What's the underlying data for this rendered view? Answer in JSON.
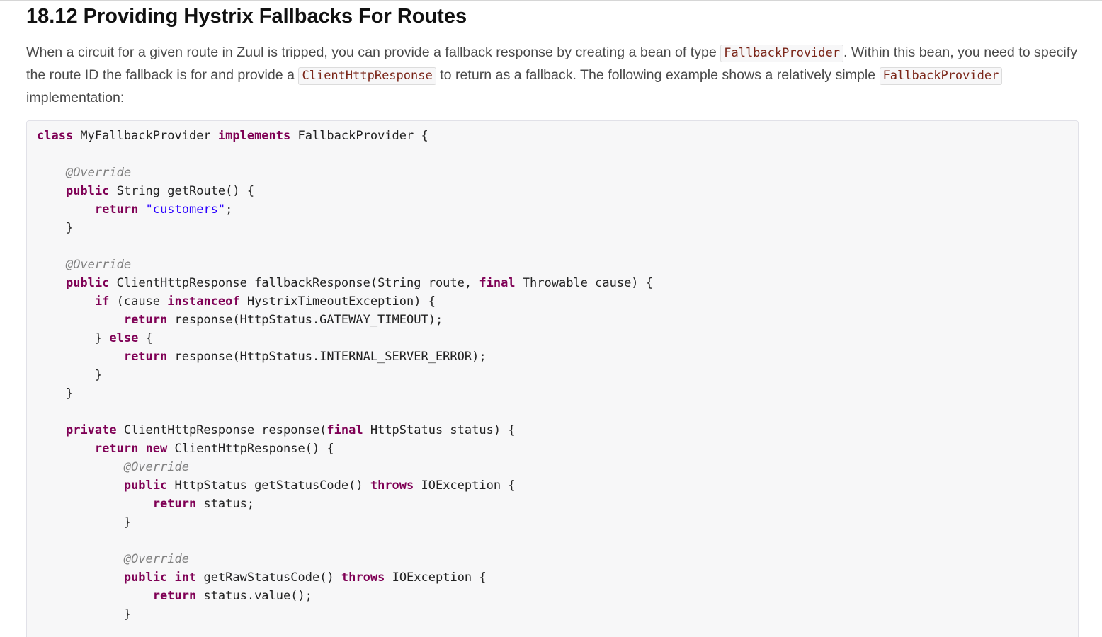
{
  "section": {
    "title": "18.12 Providing Hystrix Fallbacks For Routes"
  },
  "intro": {
    "text_1": "When a circuit for a given route in Zuul is tripped, you can provide a fallback response by creating a bean of type ",
    "code_1": "FallbackProvider",
    "text_2": ". Within this bean, you need to specify the route ID the fallback is for and provide a ",
    "code_2": "ClientHttpResponse",
    "text_3": " to return as a fallback. The following example shows a relatively simple ",
    "code_3": "FallbackProvider",
    "text_4": " implementation:"
  },
  "code_block": {
    "language": "java",
    "lines": [
      {
        "tokens": [
          {
            "t": "kw",
            "v": "class"
          },
          {
            "t": "plain",
            "v": " MyFallbackProvider "
          },
          {
            "t": "kw",
            "v": "implements"
          },
          {
            "t": "plain",
            "v": " FallbackProvider {"
          }
        ]
      },
      {
        "tokens": []
      },
      {
        "tokens": [
          {
            "t": "plain",
            "v": "    "
          },
          {
            "t": "ann",
            "v": "@Override"
          }
        ]
      },
      {
        "tokens": [
          {
            "t": "plain",
            "v": "    "
          },
          {
            "t": "kw",
            "v": "public"
          },
          {
            "t": "plain",
            "v": " String getRoute() {"
          }
        ]
      },
      {
        "tokens": [
          {
            "t": "plain",
            "v": "        "
          },
          {
            "t": "kw",
            "v": "return"
          },
          {
            "t": "plain",
            "v": " "
          },
          {
            "t": "str",
            "v": "\"customers\""
          },
          {
            "t": "plain",
            "v": ";"
          }
        ]
      },
      {
        "tokens": [
          {
            "t": "plain",
            "v": "    }"
          }
        ]
      },
      {
        "tokens": []
      },
      {
        "tokens": [
          {
            "t": "plain",
            "v": "    "
          },
          {
            "t": "ann",
            "v": "@Override"
          }
        ]
      },
      {
        "tokens": [
          {
            "t": "plain",
            "v": "    "
          },
          {
            "t": "kw",
            "v": "public"
          },
          {
            "t": "plain",
            "v": " ClientHttpResponse fallbackResponse(String route, "
          },
          {
            "t": "kw",
            "v": "final"
          },
          {
            "t": "plain",
            "v": " Throwable cause) {"
          }
        ]
      },
      {
        "tokens": [
          {
            "t": "plain",
            "v": "        "
          },
          {
            "t": "kw",
            "v": "if"
          },
          {
            "t": "plain",
            "v": " (cause "
          },
          {
            "t": "kw",
            "v": "instanceof"
          },
          {
            "t": "plain",
            "v": " HystrixTimeoutException) {"
          }
        ]
      },
      {
        "tokens": [
          {
            "t": "plain",
            "v": "            "
          },
          {
            "t": "kw",
            "v": "return"
          },
          {
            "t": "plain",
            "v": " response(HttpStatus.GATEWAY_TIMEOUT);"
          }
        ]
      },
      {
        "tokens": [
          {
            "t": "plain",
            "v": "        } "
          },
          {
            "t": "kw",
            "v": "else"
          },
          {
            "t": "plain",
            "v": " {"
          }
        ]
      },
      {
        "tokens": [
          {
            "t": "plain",
            "v": "            "
          },
          {
            "t": "kw",
            "v": "return"
          },
          {
            "t": "plain",
            "v": " response(HttpStatus.INTERNAL_SERVER_ERROR);"
          }
        ]
      },
      {
        "tokens": [
          {
            "t": "plain",
            "v": "        }"
          }
        ]
      },
      {
        "tokens": [
          {
            "t": "plain",
            "v": "    }"
          }
        ]
      },
      {
        "tokens": []
      },
      {
        "tokens": [
          {
            "t": "plain",
            "v": "    "
          },
          {
            "t": "kw",
            "v": "private"
          },
          {
            "t": "plain",
            "v": " ClientHttpResponse response("
          },
          {
            "t": "kw",
            "v": "final"
          },
          {
            "t": "plain",
            "v": " HttpStatus status) {"
          }
        ]
      },
      {
        "tokens": [
          {
            "t": "plain",
            "v": "        "
          },
          {
            "t": "kw",
            "v": "return"
          },
          {
            "t": "plain",
            "v": " "
          },
          {
            "t": "kw",
            "v": "new"
          },
          {
            "t": "plain",
            "v": " ClientHttpResponse() {"
          }
        ]
      },
      {
        "tokens": [
          {
            "t": "plain",
            "v": "            "
          },
          {
            "t": "ann",
            "v": "@Override"
          }
        ]
      },
      {
        "tokens": [
          {
            "t": "plain",
            "v": "            "
          },
          {
            "t": "kw",
            "v": "public"
          },
          {
            "t": "plain",
            "v": " HttpStatus getStatusCode() "
          },
          {
            "t": "kw",
            "v": "throws"
          },
          {
            "t": "plain",
            "v": " IOException {"
          }
        ]
      },
      {
        "tokens": [
          {
            "t": "plain",
            "v": "                "
          },
          {
            "t": "kw",
            "v": "return"
          },
          {
            "t": "plain",
            "v": " status;"
          }
        ]
      },
      {
        "tokens": [
          {
            "t": "plain",
            "v": "            }"
          }
        ]
      },
      {
        "tokens": []
      },
      {
        "tokens": [
          {
            "t": "plain",
            "v": "            "
          },
          {
            "t": "ann",
            "v": "@Override"
          }
        ]
      },
      {
        "tokens": [
          {
            "t": "plain",
            "v": "            "
          },
          {
            "t": "kw",
            "v": "public"
          },
          {
            "t": "plain",
            "v": " "
          },
          {
            "t": "kw",
            "v": "int"
          },
          {
            "t": "plain",
            "v": " getRawStatusCode() "
          },
          {
            "t": "kw",
            "v": "throws"
          },
          {
            "t": "plain",
            "v": " IOException {"
          }
        ]
      },
      {
        "tokens": [
          {
            "t": "plain",
            "v": "                "
          },
          {
            "t": "kw",
            "v": "return"
          },
          {
            "t": "plain",
            "v": " status.value();"
          }
        ]
      },
      {
        "tokens": [
          {
            "t": "plain",
            "v": "            }"
          }
        ]
      }
    ]
  },
  "colors": {
    "keyword": "#7f0055",
    "string": "#2a00ff",
    "annotation": "#808080",
    "inline_code": "#7a2518",
    "code_background": "#f7f7f8"
  }
}
